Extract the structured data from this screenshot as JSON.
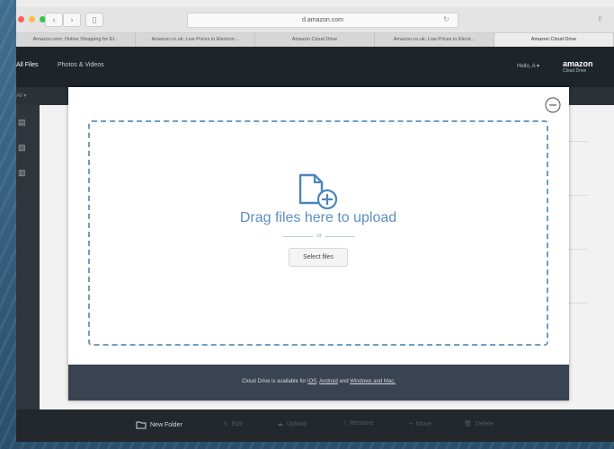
{
  "browser": {
    "address": "d.amazon.com",
    "tabs": [
      "Amazon.com: Online Shopping for El...",
      "Amazon.co.uk: Low Prices in Electron...",
      "Amazon Cloud Drive",
      "Amazon.co.uk: Low Prices in Electr...",
      "Amazon Cloud Drive"
    ],
    "colors": {
      "red": "#fc605c",
      "yellow": "#fdbc40",
      "green": "#34c84a"
    }
  },
  "header": {
    "nav": [
      "All Files",
      "Photos & Videos"
    ],
    "greeting": "Hello, A",
    "logo_text": "amazon",
    "logo_sub": "Cloud Drive"
  },
  "sub_toolbar": {
    "label": "All"
  },
  "modal": {
    "drag_text": "Drag files here to upload",
    "or_text": "or",
    "select_files": "Select files",
    "footer": {
      "prefix": "Cloud Drive is available for",
      "link1": "iOS",
      "link2": "Android",
      "and": "and",
      "link3": "Windows and Mac.",
      "bg_color": "#3a4351"
    },
    "accent_color": "#5a90c0"
  },
  "action_bar": {
    "new_folder": "New Folder",
    "edit": "Edit",
    "upload": "Upload",
    "rename": "Rename",
    "move": "Move",
    "delete": "Delete"
  }
}
